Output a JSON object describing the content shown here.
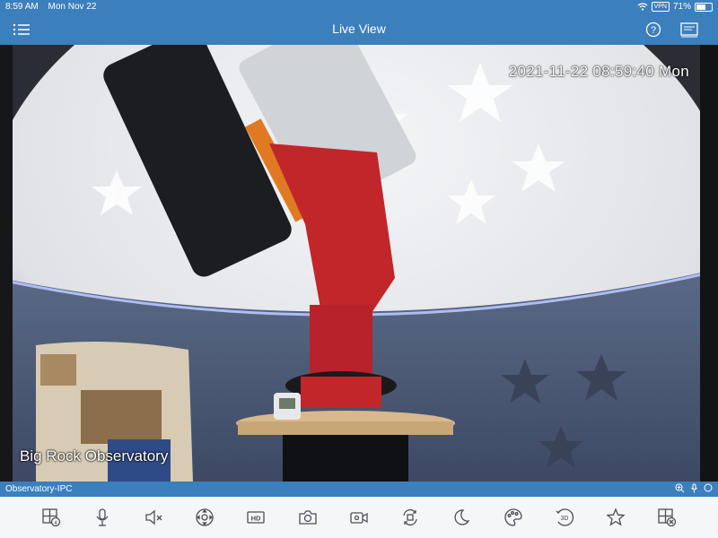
{
  "status_bar": {
    "time": "8:59 AM",
    "date": "Mon Nov 22",
    "vpn": "VPN",
    "battery": "71%",
    "battery_level": 0.71
  },
  "nav": {
    "title": "Live View",
    "menu_icon": "list-icon",
    "help_icon": "help-icon",
    "screen_icon": "screen-layout-icon"
  },
  "video": {
    "timestamp": "2021-11-22 08:59:40 Mon",
    "camera_label": "Big Rock Observatory"
  },
  "info_bar": {
    "device_name": "Observatory-IPC",
    "icons": [
      "zoom-icon",
      "mic-icon",
      "record-dot-icon"
    ]
  },
  "toolbar": {
    "items": [
      {
        "name": "multi-screen-icon"
      },
      {
        "name": "intercom-mic-icon"
      },
      {
        "name": "mute-icon"
      },
      {
        "name": "ptz-icon"
      },
      {
        "name": "hd-icon",
        "label": "HD"
      },
      {
        "name": "snapshot-icon"
      },
      {
        "name": "record-video-icon"
      },
      {
        "name": "rotate-icon"
      },
      {
        "name": "night-mode-icon"
      },
      {
        "name": "color-palette-icon"
      },
      {
        "name": "3d-position-icon",
        "label": "3D"
      },
      {
        "name": "favorite-star-icon"
      },
      {
        "name": "close-window-icon"
      }
    ]
  },
  "colors": {
    "header": "#3b7fbc",
    "toolbar_bg": "#f5f6f8"
  }
}
